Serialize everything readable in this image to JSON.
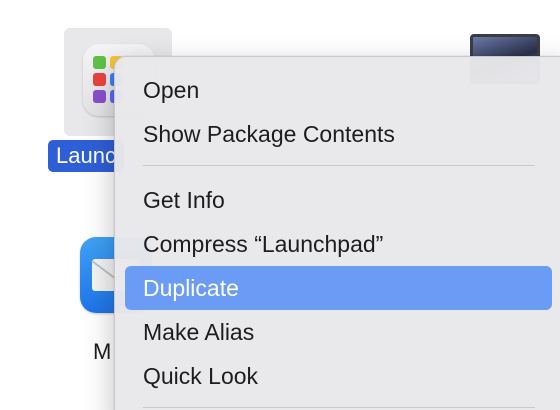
{
  "desktop": {
    "selected_item_label": "Launc",
    "mail_item_label": "M"
  },
  "context_menu": {
    "items": [
      {
        "label": "Open"
      },
      {
        "label": "Show Package Contents"
      },
      {
        "label": "Get Info"
      },
      {
        "label": "Compress “Launchpad”"
      },
      {
        "label": "Duplicate",
        "highlighted": true
      },
      {
        "label": "Make Alias"
      },
      {
        "label": "Quick Look"
      }
    ]
  },
  "colors": {
    "selection": "#2f5fd7",
    "menu_highlight": "#6b9cf5",
    "menu_background": "#e8e8ea"
  },
  "icons": [
    "launchpad-icon",
    "mail-icon",
    "laptop-icon"
  ]
}
